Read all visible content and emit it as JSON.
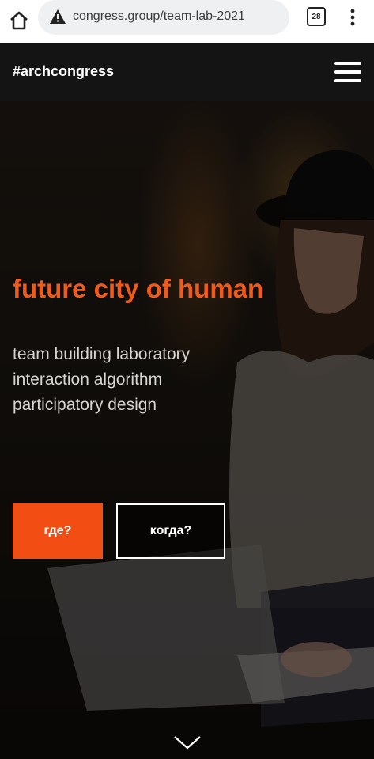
{
  "browser": {
    "url": "congress.group/team-lab-2021",
    "tab_count": "28"
  },
  "header": {
    "brand": "#archcongress"
  },
  "hero": {
    "title": "future city of human",
    "lines": [
      "team building laboratory",
      "interaction algorithm",
      "participatory design"
    ],
    "buttons": {
      "where": "где?",
      "when": "когда?"
    }
  },
  "colors": {
    "accent": "#f24d12",
    "title": "#f05a1a",
    "header_bg": "#141414"
  },
  "icons": [
    "home-icon",
    "warning-icon",
    "tabs-icon",
    "more-vert-icon",
    "hamburger-menu-icon",
    "chevron-down-icon"
  ]
}
